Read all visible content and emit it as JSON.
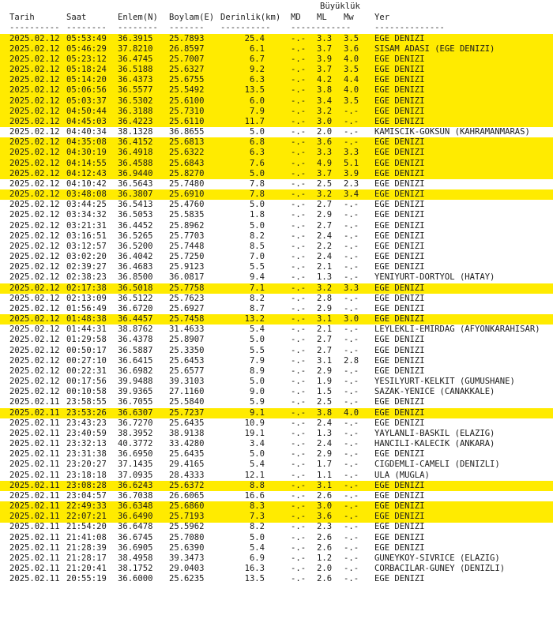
{
  "header": {
    "group": "Büyüklük",
    "columns": {
      "date": "Tarih",
      "time": "Saat",
      "lat": "Enlem(N)",
      "lon": "Boylam(E)",
      "depth": "Derinlik(km)",
      "md": "MD",
      "ml": "ML",
      "mw": "Mw",
      "location": "Yer"
    },
    "separators": {
      "date": "----------",
      "time": "--------",
      "lat": "--------",
      "lon": "-------",
      "depth": "----------",
      "mag": "------------",
      "location": "--------------"
    }
  },
  "rows": [
    {
      "date": "2025.02.12",
      "time": "05:53:49",
      "lat": "36.3915",
      "lon": "25.7893",
      "depth": "25.4",
      "md": "-.-",
      "ml": "3.3",
      "mw": "3.5",
      "location": "EGE DENIZI",
      "hl": true
    },
    {
      "date": "2025.02.12",
      "time": "05:46:29",
      "lat": "37.8210",
      "lon": "26.8597",
      "depth": "6.1",
      "md": "-.-",
      "ml": "3.7",
      "mw": "3.6",
      "location": "SISAM ADASI (EGE DENIZI)",
      "hl": true
    },
    {
      "date": "2025.02.12",
      "time": "05:23:12",
      "lat": "36.4745",
      "lon": "25.7007",
      "depth": "6.7",
      "md": "-.-",
      "ml": "3.9",
      "mw": "4.0",
      "location": "EGE DENIZI",
      "hl": true
    },
    {
      "date": "2025.02.12",
      "time": "05:18:24",
      "lat": "36.5188",
      "lon": "25.6327",
      "depth": "9.2",
      "md": "-.-",
      "ml": "3.7",
      "mw": "3.5",
      "location": "EGE DENIZI",
      "hl": true
    },
    {
      "date": "2025.02.12",
      "time": "05:14:20",
      "lat": "36.4373",
      "lon": "25.6755",
      "depth": "6.3",
      "md": "-.-",
      "ml": "4.2",
      "mw": "4.4",
      "location": "EGE DENIZI",
      "hl": true
    },
    {
      "date": "2025.02.12",
      "time": "05:06:56",
      "lat": "36.5577",
      "lon": "25.5492",
      "depth": "13.5",
      "md": "-.-",
      "ml": "3.8",
      "mw": "4.0",
      "location": "EGE DENIZI",
      "hl": true
    },
    {
      "date": "2025.02.12",
      "time": "05:03:37",
      "lat": "36.5302",
      "lon": "25.6100",
      "depth": "6.0",
      "md": "-.-",
      "ml": "3.4",
      "mw": "3.5",
      "location": "EGE DENIZI",
      "hl": true
    },
    {
      "date": "2025.02.12",
      "time": "04:50:44",
      "lat": "36.3188",
      "lon": "25.7310",
      "depth": "7.9",
      "md": "-.-",
      "ml": "3.2",
      "mw": "-.-",
      "location": "EGE DENIZI",
      "hl": true
    },
    {
      "date": "2025.02.12",
      "time": "04:45:03",
      "lat": "36.4223",
      "lon": "25.6110",
      "depth": "11.7",
      "md": "-.-",
      "ml": "3.0",
      "mw": "-.-",
      "location": "EGE DENIZI",
      "hl": true
    },
    {
      "date": "2025.02.12",
      "time": "04:40:34",
      "lat": "38.1328",
      "lon": "36.8655",
      "depth": "5.0",
      "md": "-.-",
      "ml": "2.0",
      "mw": "-.-",
      "location": "KAMISCIK-GOKSUN (KAHRAMANMARAS)",
      "hl": false
    },
    {
      "date": "2025.02.12",
      "time": "04:35:08",
      "lat": "36.4152",
      "lon": "25.6813",
      "depth": "6.8",
      "md": "-.-",
      "ml": "3.6",
      "mw": "-.-",
      "location": "EGE DENIZI",
      "hl": true
    },
    {
      "date": "2025.02.12",
      "time": "04:30:19",
      "lat": "36.4918",
      "lon": "25.6322",
      "depth": "6.3",
      "md": "-.-",
      "ml": "3.3",
      "mw": "3.3",
      "location": "EGE DENIZI",
      "hl": true
    },
    {
      "date": "2025.02.12",
      "time": "04:14:55",
      "lat": "36.4588",
      "lon": "25.6843",
      "depth": "7.6",
      "md": "-.-",
      "ml": "4.9",
      "mw": "5.1",
      "location": "EGE DENIZI",
      "hl": true
    },
    {
      "date": "2025.02.12",
      "time": "04:12:43",
      "lat": "36.9440",
      "lon": "25.8270",
      "depth": "5.0",
      "md": "-.-",
      "ml": "3.7",
      "mw": "3.9",
      "location": "EGE DENIZI",
      "hl": true
    },
    {
      "date": "2025.02.12",
      "time": "04:10:42",
      "lat": "36.5643",
      "lon": "25.7480",
      "depth": "7.8",
      "md": "-.-",
      "ml": "2.5",
      "mw": "2.3",
      "location": "EGE DENIZI",
      "hl": false
    },
    {
      "date": "2025.02.12",
      "time": "03:48:08",
      "lat": "36.3807",
      "lon": "25.6910",
      "depth": "7.8",
      "md": "-.-",
      "ml": "3.2",
      "mw": "3.4",
      "location": "EGE DENIZI",
      "hl": true
    },
    {
      "date": "2025.02.12",
      "time": "03:44:25",
      "lat": "36.5413",
      "lon": "25.4760",
      "depth": "5.0",
      "md": "-.-",
      "ml": "2.7",
      "mw": "-.-",
      "location": "EGE DENIZI",
      "hl": false
    },
    {
      "date": "2025.02.12",
      "time": "03:34:32",
      "lat": "36.5053",
      "lon": "25.5835",
      "depth": "1.8",
      "md": "-.-",
      "ml": "2.9",
      "mw": "-.-",
      "location": "EGE DENIZI",
      "hl": false
    },
    {
      "date": "2025.02.12",
      "time": "03:21:31",
      "lat": "36.4452",
      "lon": "25.8962",
      "depth": "5.0",
      "md": "-.-",
      "ml": "2.7",
      "mw": "-.-",
      "location": "EGE DENIZI",
      "hl": false
    },
    {
      "date": "2025.02.12",
      "time": "03:16:51",
      "lat": "36.5265",
      "lon": "25.7703",
      "depth": "8.2",
      "md": "-.-",
      "ml": "2.4",
      "mw": "-.-",
      "location": "EGE DENIZI",
      "hl": false
    },
    {
      "date": "2025.02.12",
      "time": "03:12:57",
      "lat": "36.5200",
      "lon": "25.7448",
      "depth": "8.5",
      "md": "-.-",
      "ml": "2.2",
      "mw": "-.-",
      "location": "EGE DENIZI",
      "hl": false
    },
    {
      "date": "2025.02.12",
      "time": "03:02:20",
      "lat": "36.4042",
      "lon": "25.7250",
      "depth": "7.0",
      "md": "-.-",
      "ml": "2.4",
      "mw": "-.-",
      "location": "EGE DENIZI",
      "hl": false
    },
    {
      "date": "2025.02.12",
      "time": "02:39:27",
      "lat": "36.4683",
      "lon": "25.9123",
      "depth": "5.5",
      "md": "-.-",
      "ml": "2.1",
      "mw": "-.-",
      "location": "EGE DENIZI",
      "hl": false
    },
    {
      "date": "2025.02.12",
      "time": "02:38:23",
      "lat": "36.8500",
      "lon": "36.0817",
      "depth": "9.4",
      "md": "-.-",
      "ml": "1.3",
      "mw": "-.-",
      "location": "YENIYURT-DORTYOL (HATAY)",
      "hl": false
    },
    {
      "date": "2025.02.12",
      "time": "02:17:38",
      "lat": "36.5018",
      "lon": "25.7758",
      "depth": "7.1",
      "md": "-.-",
      "ml": "3.2",
      "mw": "3.3",
      "location": "EGE DENIZI",
      "hl": true
    },
    {
      "date": "2025.02.12",
      "time": "02:13:09",
      "lat": "36.5122",
      "lon": "25.7623",
      "depth": "8.2",
      "md": "-.-",
      "ml": "2.8",
      "mw": "-.-",
      "location": "EGE DENIZI",
      "hl": false
    },
    {
      "date": "2025.02.12",
      "time": "01:56:49",
      "lat": "36.6720",
      "lon": "25.6927",
      "depth": "8.7",
      "md": "-.-",
      "ml": "2.9",
      "mw": "-.-",
      "location": "EGE DENIZI",
      "hl": false
    },
    {
      "date": "2025.02.12",
      "time": "01:48:38",
      "lat": "36.4457",
      "lon": "25.7458",
      "depth": "13.2",
      "md": "-.-",
      "ml": "3.1",
      "mw": "3.0",
      "location": "EGE DENIZI",
      "hl": true
    },
    {
      "date": "2025.02.12",
      "time": "01:44:31",
      "lat": "38.8762",
      "lon": "31.4633",
      "depth": "5.4",
      "md": "-.-",
      "ml": "2.1",
      "mw": "-.-",
      "location": "LEYLEKLI-EMIRDAG (AFYONKARAHISAR)",
      "hl": false
    },
    {
      "date": "2025.02.12",
      "time": "01:29:58",
      "lat": "36.4378",
      "lon": "25.8907",
      "depth": "5.0",
      "md": "-.-",
      "ml": "2.7",
      "mw": "-.-",
      "location": "EGE DENIZI",
      "hl": false
    },
    {
      "date": "2025.02.12",
      "time": "00:50:17",
      "lat": "36.5887",
      "lon": "25.3350",
      "depth": "5.5",
      "md": "-.-",
      "ml": "2.7",
      "mw": "-.-",
      "location": "EGE DENIZI",
      "hl": false
    },
    {
      "date": "2025.02.12",
      "time": "00:27:10",
      "lat": "36.6415",
      "lon": "25.6453",
      "depth": "7.9",
      "md": "-.-",
      "ml": "3.1",
      "mw": "2.8",
      "location": "EGE DENIZI",
      "hl": false
    },
    {
      "date": "2025.02.12",
      "time": "00:22:31",
      "lat": "36.6982",
      "lon": "25.6577",
      "depth": "8.9",
      "md": "-.-",
      "ml": "2.9",
      "mw": "-.-",
      "location": "EGE DENIZI",
      "hl": false
    },
    {
      "date": "2025.02.12",
      "time": "00:17:56",
      "lat": "39.9488",
      "lon": "39.3103",
      "depth": "5.0",
      "md": "-.-",
      "ml": "1.9",
      "mw": "-.-",
      "location": "YESILYURT-KELKIT (GUMUSHANE)",
      "hl": false
    },
    {
      "date": "2025.02.12",
      "time": "00:10:58",
      "lat": "39.9365",
      "lon": "27.1160",
      "depth": "9.0",
      "md": "-.-",
      "ml": "1.5",
      "mw": "-.-",
      "location": "SAZAK-YENICE (CANAKKALE)",
      "hl": false
    },
    {
      "date": "2025.02.11",
      "time": "23:58:55",
      "lat": "36.7055",
      "lon": "25.5840",
      "depth": "5.9",
      "md": "-.-",
      "ml": "2.5",
      "mw": "-.-",
      "location": "EGE DENIZI",
      "hl": false
    },
    {
      "date": "2025.02.11",
      "time": "23:53:26",
      "lat": "36.6307",
      "lon": "25.7237",
      "depth": "9.1",
      "md": "-.-",
      "ml": "3.8",
      "mw": "4.0",
      "location": "EGE DENIZI",
      "hl": true
    },
    {
      "date": "2025.02.11",
      "time": "23:43:23",
      "lat": "36.7270",
      "lon": "25.6435",
      "depth": "10.9",
      "md": "-.-",
      "ml": "2.4",
      "mw": "-.-",
      "location": "EGE DENIZI",
      "hl": false
    },
    {
      "date": "2025.02.11",
      "time": "23:40:59",
      "lat": "38.3952",
      "lon": "38.9138",
      "depth": "19.1",
      "md": "-.-",
      "ml": "1.3",
      "mw": "-.-",
      "location": "YAYLANLI-BASKIL (ELAZIG)",
      "hl": false
    },
    {
      "date": "2025.02.11",
      "time": "23:32:13",
      "lat": "40.3772",
      "lon": "33.4280",
      "depth": "3.4",
      "md": "-.-",
      "ml": "2.4",
      "mw": "-.-",
      "location": "HANCILI-KALECIK (ANKARA)",
      "hl": false
    },
    {
      "date": "2025.02.11",
      "time": "23:31:38",
      "lat": "36.6950",
      "lon": "25.6435",
      "depth": "5.0",
      "md": "-.-",
      "ml": "2.9",
      "mw": "-.-",
      "location": "EGE DENIZI",
      "hl": false
    },
    {
      "date": "2025.02.11",
      "time": "23:20:27",
      "lat": "37.1435",
      "lon": "29.4165",
      "depth": "5.4",
      "md": "-.-",
      "ml": "1.7",
      "mw": "-.-",
      "location": "CIGDEMLI-CAMELI (DENIZLI)",
      "hl": false
    },
    {
      "date": "2025.02.11",
      "time": "23:18:18",
      "lat": "37.0935",
      "lon": "28.4333",
      "depth": "12.1",
      "md": "-.-",
      "ml": "1.1",
      "mw": "-.-",
      "location": "ULA (MUGLA)",
      "hl": false
    },
    {
      "date": "2025.02.11",
      "time": "23:08:28",
      "lat": "36.6243",
      "lon": "25.6372",
      "depth": "8.8",
      "md": "-.-",
      "ml": "3.1",
      "mw": "-.-",
      "location": "EGE DENIZI",
      "hl": true
    },
    {
      "date": "2025.02.11",
      "time": "23:04:57",
      "lat": "36.7038",
      "lon": "26.6065",
      "depth": "16.6",
      "md": "-.-",
      "ml": "2.6",
      "mw": "-.-",
      "location": "EGE DENIZI",
      "hl": false
    },
    {
      "date": "2025.02.11",
      "time": "22:49:33",
      "lat": "36.6348",
      "lon": "25.6860",
      "depth": "8.3",
      "md": "-.-",
      "ml": "3.0",
      "mw": "-.-",
      "location": "EGE DENIZI",
      "hl": true
    },
    {
      "date": "2025.02.11",
      "time": "22:07:21",
      "lat": "36.6490",
      "lon": "25.7193",
      "depth": "7.3",
      "md": "-.-",
      "ml": "3.6",
      "mw": "-.-",
      "location": "EGE DENIZI",
      "hl": true
    },
    {
      "date": "2025.02.11",
      "time": "21:54:20",
      "lat": "36.6478",
      "lon": "25.5962",
      "depth": "8.2",
      "md": "-.-",
      "ml": "2.3",
      "mw": "-.-",
      "location": "EGE DENIZI",
      "hl": false
    },
    {
      "date": "2025.02.11",
      "time": "21:41:08",
      "lat": "36.6745",
      "lon": "25.7080",
      "depth": "5.0",
      "md": "-.-",
      "ml": "2.6",
      "mw": "-.-",
      "location": "EGE DENIZI",
      "hl": false
    },
    {
      "date": "2025.02.11",
      "time": "21:28:39",
      "lat": "36.6905",
      "lon": "25.6390",
      "depth": "5.4",
      "md": "-.-",
      "ml": "2.6",
      "mw": "-.-",
      "location": "EGE DENIZI",
      "hl": false
    },
    {
      "date": "2025.02.11",
      "time": "21:28:17",
      "lat": "38.4958",
      "lon": "39.3473",
      "depth": "6.9",
      "md": "-.-",
      "ml": "1.2",
      "mw": "-.-",
      "location": "GUNEYKOY-SIVRICE (ELAZIG)",
      "hl": false
    },
    {
      "date": "2025.02.11",
      "time": "21:20:41",
      "lat": "38.1752",
      "lon": "29.0403",
      "depth": "16.3",
      "md": "-.-",
      "ml": "2.0",
      "mw": "-.-",
      "location": "CORBACILAR-GUNEY (DENIZLI)",
      "hl": false
    },
    {
      "date": "2025.02.11",
      "time": "20:55:19",
      "lat": "36.6000",
      "lon": "25.6235",
      "depth": "13.5",
      "md": "-.-",
      "ml": "2.6",
      "mw": "-.-",
      "location": "EGE DENIZI",
      "hl": false
    }
  ]
}
